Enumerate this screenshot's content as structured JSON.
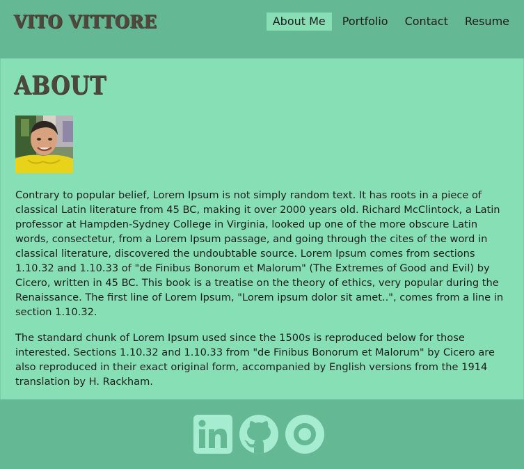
{
  "header": {
    "brand": "VITO VITTORE",
    "nav": [
      {
        "label": "About Me",
        "active": true
      },
      {
        "label": "Portfolio",
        "active": false
      },
      {
        "label": "Contact",
        "active": false
      },
      {
        "label": "Resume",
        "active": false
      }
    ]
  },
  "main": {
    "title": "ABOUT",
    "paragraphs": [
      "Contrary to popular belief, Lorem Ipsum is not simply random text. It has roots in a piece of classical Latin literature from 45 BC, making it over 2000 years old. Richard McClintock, a Latin professor at Hampden-Sydney College in Virginia, looked up one of the more obscure Latin words, consectetur, from a Lorem Ipsum passage, and going through the cites of the word in classical literature, discovered the undoubtable source. Lorem Ipsum comes from sections 1.10.32 and 1.10.33 of \"de Finibus Bonorum et Malorum\" (The Extremes of Good and Evil) by Cicero, written in 45 BC. This book is a treatise on the theory of ethics, very popular during the Renaissance. The first line of Lorem Ipsum, \"Lorem ipsum dolor sit amet..\", comes from a line in section 1.10.32.",
      "The standard chunk of Lorem Ipsum used since the 1500s is reproduced below for those interested. Sections 1.10.32 and 1.10.33 from \"de Finibus Bonorum et Malorum\" by Cicero are also reproduced in their exact original form, accompanied by English versions from the 1914 translation by H. Rackham."
    ]
  },
  "footer": {
    "social_icons": [
      "linkedin-icon",
      "github-icon",
      "portfolio-icon"
    ]
  },
  "colors": {
    "header_bg": "#64b893",
    "content_bg": "#87dfb5",
    "active_nav_bg": "#88dfb6",
    "icon_color": "#a6ecd0",
    "heading_color": "#4d473d"
  }
}
